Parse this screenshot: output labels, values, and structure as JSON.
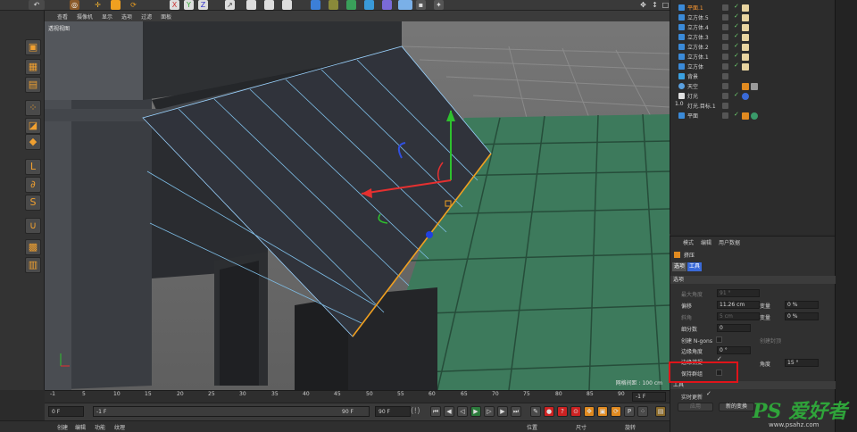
{
  "viewport": {
    "menu": [
      "查看",
      "摄像机",
      "显示",
      "选项",
      "过滤",
      "面板"
    ],
    "view_name": "透视视图",
    "grid_spacing": "网格间距 : 100 cm"
  },
  "timeline": {
    "ticks": [
      "-1",
      "5",
      "10",
      "15",
      "20",
      "25",
      "30",
      "35",
      "40",
      "45",
      "50",
      "55",
      "60",
      "65",
      "70",
      "75",
      "80",
      "85",
      "90"
    ],
    "end_frame": "-1 F"
  },
  "transport": {
    "current_frame": "0 F",
    "start_frame": "-1 F",
    "range_end": "90 F",
    "end_field": "90 F"
  },
  "bottom_tabs": {
    "left": [
      "创建",
      "编辑",
      "功能",
      "纹理"
    ],
    "right": [
      "位置",
      "尺寸",
      "旋转"
    ]
  },
  "objects": [
    {
      "name": "平面.1",
      "selected": true
    },
    {
      "name": "立方体.5",
      "selected": false
    },
    {
      "name": "立方体.4",
      "selected": false
    },
    {
      "name": "立方体.3",
      "selected": false
    },
    {
      "name": "立方体.2",
      "selected": false
    },
    {
      "name": "立方体.1",
      "selected": false
    },
    {
      "name": "立方体",
      "selected": false
    },
    {
      "name": "背景",
      "selected": false
    },
    {
      "name": "天空",
      "selected": false
    },
    {
      "name": "灯光",
      "selected": false
    },
    {
      "name": "灯光.目标.1",
      "selected": false
    },
    {
      "name": "平面",
      "selected": false
    }
  ],
  "attributes": {
    "menu": [
      "模式",
      "编辑",
      "用户数据"
    ],
    "tool_name": "挤压",
    "tabs": [
      "选项",
      "工具"
    ],
    "section_options": "选项",
    "max_angle_label": "最大角度",
    "max_angle_value": "91 °",
    "offset_label": "偏移",
    "offset_value": "11.26 cm",
    "variance_label": "变量",
    "variance_value": "0 %",
    "bevel_label": "斜角",
    "bevel_value": "5 cm",
    "variance2_label": "变量",
    "variance2_value": "0 %",
    "subdivision_label": "细分数",
    "subdivision_value": "0",
    "create_ngons_label": "创建 N-gons",
    "create_cap_label": "创建封顶",
    "edge_angle_label": "边缘角度",
    "edge_angle_value": "0 °",
    "edge_snap_label": "边缘捕捉",
    "angle_label": "角度",
    "angle_value": "15 °",
    "preserve_groups_label": "保持群组",
    "section_tool": "工具",
    "realtime_update_label": "实时更新",
    "apply_button": "应用",
    "new_transform_button": "新的变换"
  },
  "watermark": {
    "brand": "PS 爱好者",
    "url": "www.psahz.com"
  },
  "center_logo": "(!)",
  "colors": {
    "selected_object": "#ff9a32",
    "highlight_box": "#e0141a",
    "floor": "#3d7a5c",
    "axis_x": "#e53030",
    "axis_y": "#2ec12e",
    "axis_z": "#3050e0"
  }
}
